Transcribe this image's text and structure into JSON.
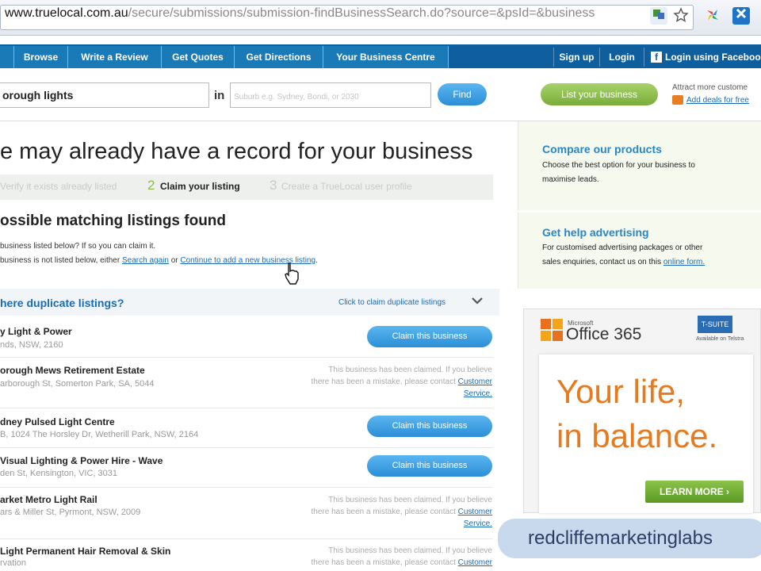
{
  "browser": {
    "url_host": "www.truelocal.com.au",
    "url_path": "/secure/submissions/submission-findBusinessSearch.do?source=&psId=&business"
  },
  "nav": {
    "tabs": [
      "Browse",
      "Write a Review",
      "Get Quotes",
      "Get Directions",
      "Your Business Centre"
    ],
    "right": [
      "Sign up",
      "Login",
      "Login using Faceboo"
    ]
  },
  "search": {
    "what_value": "orough lights",
    "in_label": "in",
    "where_placeholder": "Suburb e.g. Sydney, Bondi, or 2030",
    "find_label": "Find",
    "list_business_label": "List your business",
    "attract_text": "Attract more custome",
    "add_deals_text": "Add deals for free"
  },
  "main": {
    "heading": "e may already have a record for your business",
    "steps": [
      {
        "num": "",
        "label": "Verify it exists already listed"
      },
      {
        "num": "2",
        "label": "Claim your listing"
      },
      {
        "num": "3",
        "label": "Create a TrueLocal user profile"
      }
    ],
    "subheading": "ossible matching listings found",
    "line1": "business listed below? If so you can claim it.",
    "line2_pre": "business is not listed below, either ",
    "search_again": "Search again",
    "or": " or ",
    "continue_link": "Continue to add a new business listing",
    "dup_title": "here duplicate listings?",
    "dup_right": "Click to claim duplicate listings",
    "claim_label": "Claim this business",
    "claimed_text_1": "This business has been claimed. If you believe",
    "claimed_text_2": "there has been a mistake, please contact",
    "customer": "Customer",
    "service": "Service.",
    "listings": [
      {
        "name": "y Light & Power",
        "address": "nds, NSW, 2160"
      },
      {
        "name": "orough Mews Retirement Estate",
        "address": "arborough St, Somerton Park, SA, 5044"
      },
      {
        "name": "dney Pulsed Light Centre",
        "address": "B, 1024 The Horsley Dr, Wetherill Park, NSW, 2164"
      },
      {
        "name": "Visual Lighting & Power Hire - Wave",
        "address": "den St, Kensington, VIC, 3031"
      },
      {
        "name": "arket Metro Light Rail",
        "address": "ars & Miller St, Pyrmont, NSW, 2009"
      },
      {
        "name": "Light Permanent Hair Removal & Skin",
        "address": "rvation"
      }
    ]
  },
  "sidebar": {
    "compare_title": "Compare our products",
    "compare_text_1": "Choose the best option for your business to",
    "compare_text_2": "maximise leads.",
    "help_title": "Get help advertising",
    "help_text_1": "For customised advertising packages or other",
    "help_text_2": "sales enquiries, contact us on this ",
    "online_form": "online form."
  },
  "ad": {
    "ms_small": "Microsoft",
    "office": "Office 365",
    "suite": "T-SUITE",
    "suite_sub": "Available on Telstra",
    "line1": "Your life,",
    "line2": "in balance.",
    "learn": "LEARN MORE"
  },
  "watermark": "redcliffemarketinglabs"
}
